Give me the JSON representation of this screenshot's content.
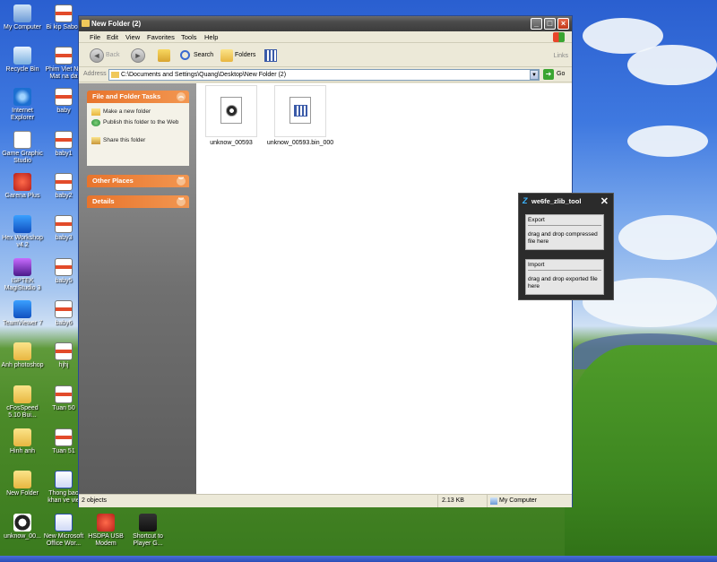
{
  "desktop": {
    "icons": [
      {
        "label": "My Computer",
        "glyph": "computer-icon"
      },
      {
        "label": "Recycle Bin",
        "glyph": "recycle-bin-icon"
      },
      {
        "label": "Internet Explorer",
        "glyph": "ie-icon"
      },
      {
        "label": "Game Graphic Studio",
        "glyph": "app-icon"
      },
      {
        "label": "Garena Plus",
        "glyph": "garena-icon"
      },
      {
        "label": "Hex Workshop v4.2",
        "glyph": "hex-icon"
      },
      {
        "label": "ISPTEK MagiStudio 3",
        "glyph": "app-icon"
      },
      {
        "label": "TeamViewer 7",
        "glyph": "teamviewer-icon"
      },
      {
        "label": "Anh photoshop",
        "glyph": "folder-icon"
      },
      {
        "label": "cFosSpeed 5.10 Bui...",
        "glyph": "folder-icon"
      },
      {
        "label": "Hinh anh",
        "glyph": "folder-icon"
      },
      {
        "label": "New Folder",
        "glyph": "folder-icon"
      },
      {
        "label": "unknow_00...",
        "glyph": "file-icon"
      },
      {
        "label": "Bi kip Sabon",
        "glyph": "doc-icon"
      },
      {
        "label": "Phim Viet N - Mat na da",
        "glyph": "doc-icon"
      },
      {
        "label": "baby",
        "glyph": "doc-icon"
      },
      {
        "label": "baby1",
        "glyph": "doc-icon"
      },
      {
        "label": "baby2",
        "glyph": "doc-icon"
      },
      {
        "label": "baby3",
        "glyph": "doc-icon"
      },
      {
        "label": "baby5",
        "glyph": "doc-icon"
      },
      {
        "label": "baby6",
        "glyph": "doc-icon"
      },
      {
        "label": "hjhj",
        "glyph": "doc-icon"
      },
      {
        "label": "Tuan 50",
        "glyph": "doc-icon"
      },
      {
        "label": "Tuan 51",
        "glyph": "doc-icon"
      },
      {
        "label": "Thong bao khan ve vie",
        "glyph": "word-icon"
      },
      {
        "label": "New Microsoft Office Wor...",
        "glyph": "word-icon"
      },
      {
        "label": "HSDPA USB Modem",
        "glyph": "modem-icon"
      },
      {
        "label": "Shortcut to Player G...",
        "glyph": "shortcut-icon"
      }
    ]
  },
  "explorer": {
    "title": "New Folder (2)",
    "menu": [
      "File",
      "Edit",
      "View",
      "Favorites",
      "Tools",
      "Help"
    ],
    "toolbar": {
      "back": "Back",
      "search": "Search",
      "folders": "Folders"
    },
    "address": {
      "label": "Address",
      "path": "C:\\Documents and Settings\\Quang\\Desktop\\New Folder (2)",
      "go": "Go",
      "links": "Links"
    },
    "tasks": {
      "file_folder_title": "File and Folder Tasks",
      "links": [
        "Make a new folder",
        "Publish this folder to the Web",
        "Share this folder"
      ],
      "other_places_title": "Other Places",
      "details_title": "Details"
    },
    "files": [
      {
        "name": "unknow_00593",
        "glyph": "globe-file-icon"
      },
      {
        "name": "unknow_00593.bin_000",
        "glyph": "grid-file-icon"
      }
    ],
    "status": {
      "objects": "2 objects",
      "size": "2.13 KB",
      "location": "My Computer"
    }
  },
  "tool": {
    "title": "we6fe_zlib_tool",
    "export_caption": "Export",
    "export_text": "drag and drop compressed file here",
    "import_caption": "Import",
    "import_text": "drag and drop exported file here"
  }
}
